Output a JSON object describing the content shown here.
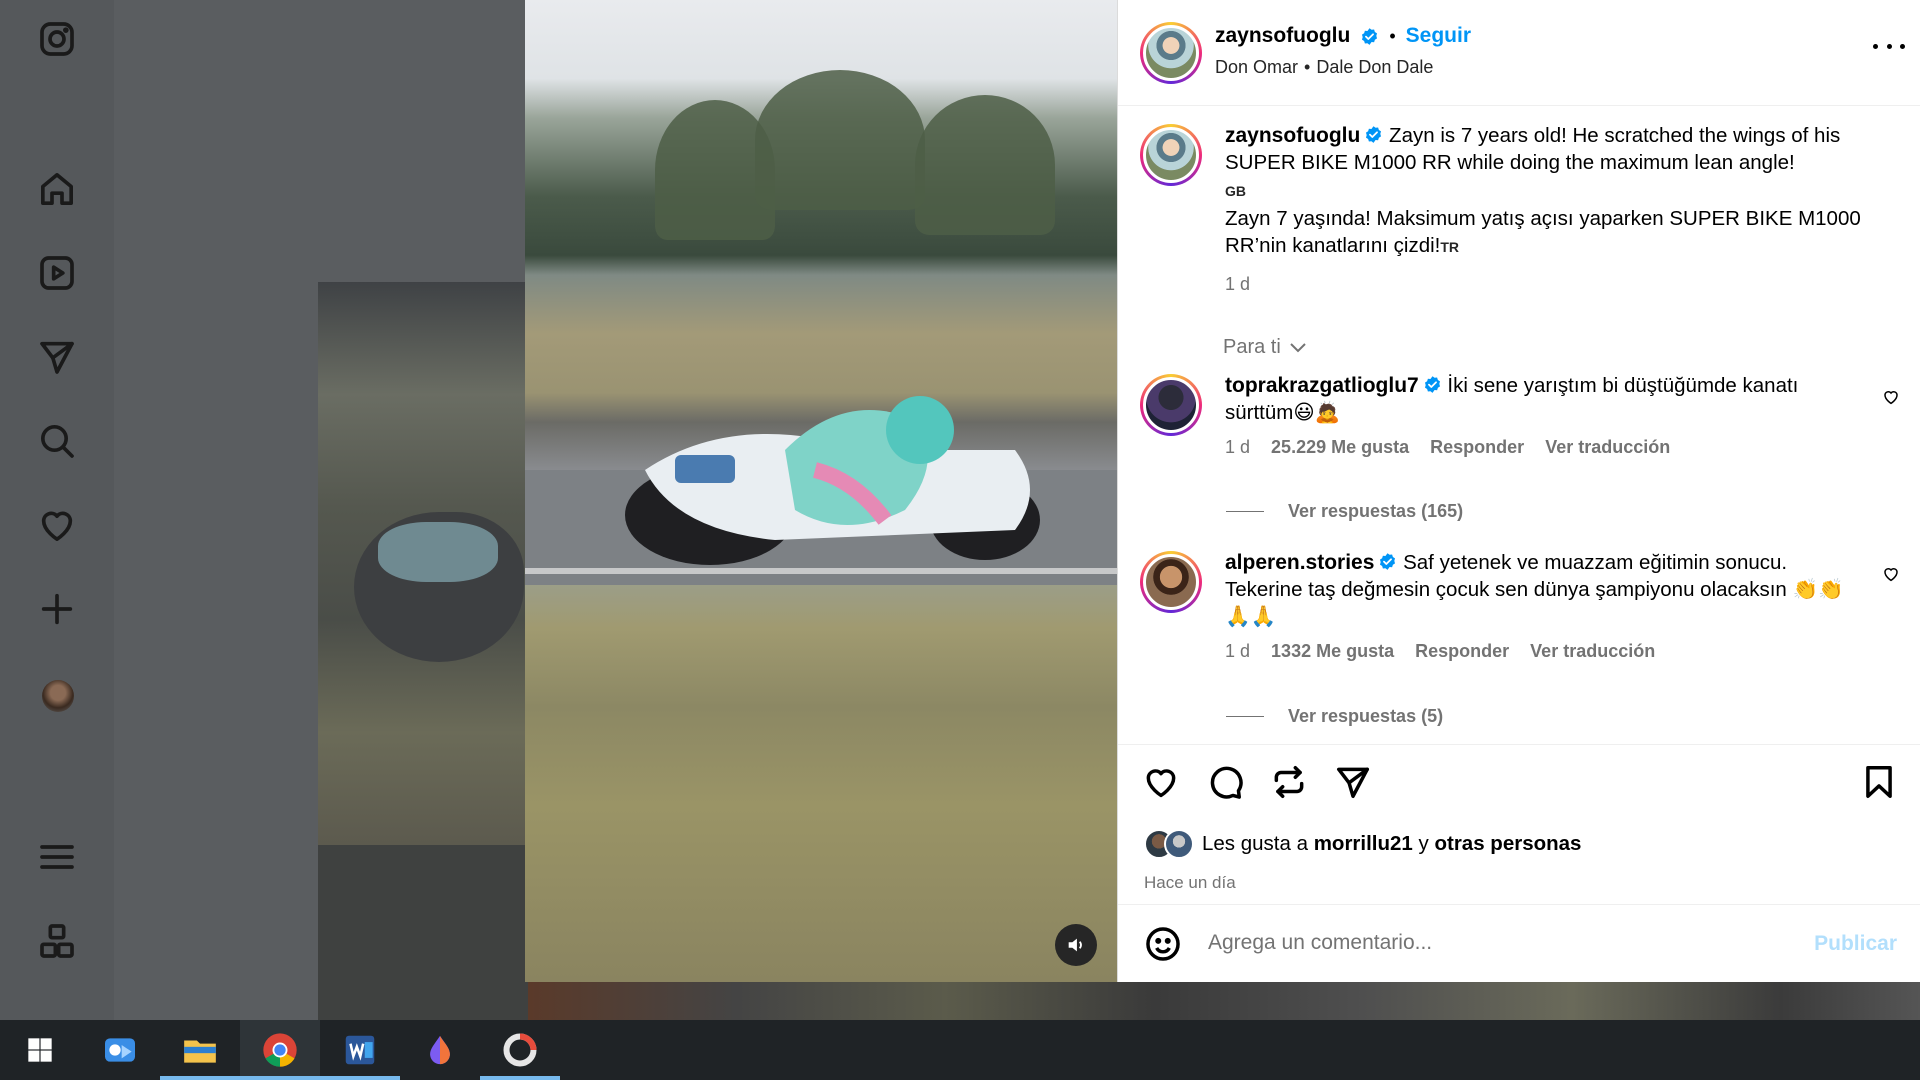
{
  "post": {
    "author": "zaynsofuoglu",
    "follow_label": "Seguir",
    "separator": "•",
    "audio_artist": "Don Omar",
    "audio_track": "Dale Don Dale",
    "caption_en": "Zayn is 7 years old! He scratched the wings of his SUPER BIKE M1000 RR while doing the maximum lean angle!",
    "caption_en_tag": "GB",
    "caption_tr": "Zayn 7 yaşında! Maksimum yatış açısı yaparken SUPER BIKE M1000 RR’nin kanatlarını çizdi!",
    "caption_tr_tag": "TR",
    "caption_time": "1 d",
    "sort_label": "Para ti"
  },
  "comments": [
    {
      "user": "toprakrazgatlioglu7",
      "text": "İki sene yarıştım bi düştüğümde kanatı sürttüm😃🙇",
      "time": "1 d",
      "likes": "25.229 Me gusta",
      "reply": "Responder",
      "translate": "Ver traducción",
      "replies": "Ver respuestas (165)"
    },
    {
      "user": "alperen.stories",
      "text": "Saf yetenek ve muazzam eğitimin sonucu. Tekerine taş değmesin çocuk sen dünya şampiyonu olacaksın 👏👏🙏🙏",
      "time": "1 d",
      "likes": "1332 Me gusta",
      "reply": "Responder",
      "translate": "Ver traducción",
      "replies": "Ver respuestas (5)"
    }
  ],
  "likes": {
    "prefix": "Les gusta a",
    "user": "morrillu21",
    "conj": "y",
    "others": "otras personas",
    "ago": "Hace un día"
  },
  "composer": {
    "placeholder": "Agrega un comentario...",
    "publish": "Publicar"
  },
  "sidebar_icons": [
    "instagram-icon",
    "home-icon",
    "reels-icon",
    "direct-icon",
    "search-icon",
    "heart-icon",
    "create-icon",
    "profile-avatar",
    "menu-icon",
    "apps-icon"
  ],
  "taskbar_apps": [
    "start-icon",
    "outlook-icon",
    "file-explorer-icon",
    "chrome-icon",
    "word-icon",
    "drop-app-icon",
    "circle-app-icon"
  ],
  "colors": {
    "link": "#0095f6",
    "publish_disabled": "#b2dffc",
    "muted": "#737373",
    "verified": "#0095f6"
  }
}
